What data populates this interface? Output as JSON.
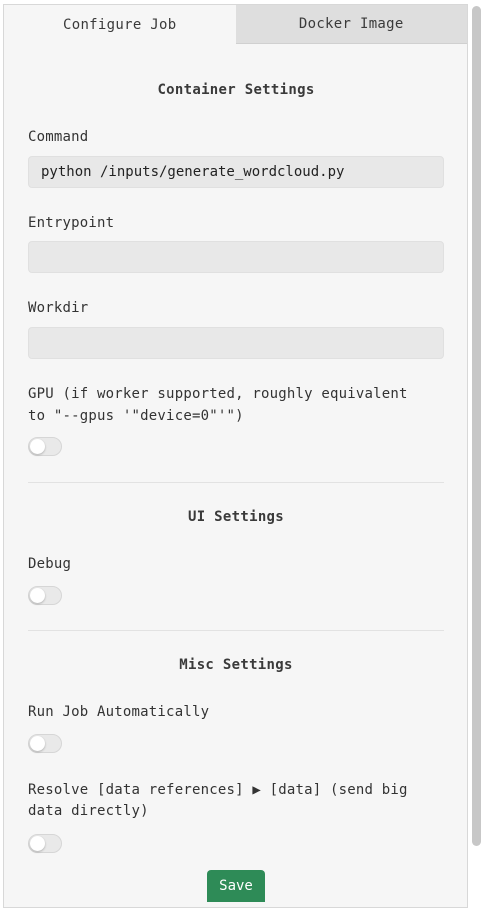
{
  "tabs": [
    {
      "label": "Configure Job",
      "active": true
    },
    {
      "label": "Docker Image",
      "active": false
    }
  ],
  "container_settings": {
    "title": "Container Settings",
    "command": {
      "label": "Command",
      "value": "python /inputs/generate_wordcloud.py"
    },
    "entrypoint": {
      "label": "Entrypoint",
      "value": ""
    },
    "workdir": {
      "label": "Workdir",
      "value": ""
    },
    "gpu": {
      "label_line1": "GPU (if worker supported, roughly equivalent",
      "label_line2": "to \"--gpus '\"device=0\"'\")",
      "enabled": false
    }
  },
  "ui_settings": {
    "title": "UI Settings",
    "debug": {
      "label": "Debug",
      "enabled": false
    }
  },
  "misc_settings": {
    "title": "Misc Settings",
    "run_auto": {
      "label": "Run Job Automatically",
      "enabled": false
    },
    "resolve": {
      "label_line1": "Resolve [data references] ▶ [data] (send big",
      "label_line2": "data directly)",
      "enabled": false
    }
  },
  "save_label": "Save",
  "colors": {
    "accent": "#2e8b57",
    "panel_bg": "#f6f6f6",
    "input_bg": "#e8e8e8",
    "inactive_tab_bg": "#dedede"
  }
}
